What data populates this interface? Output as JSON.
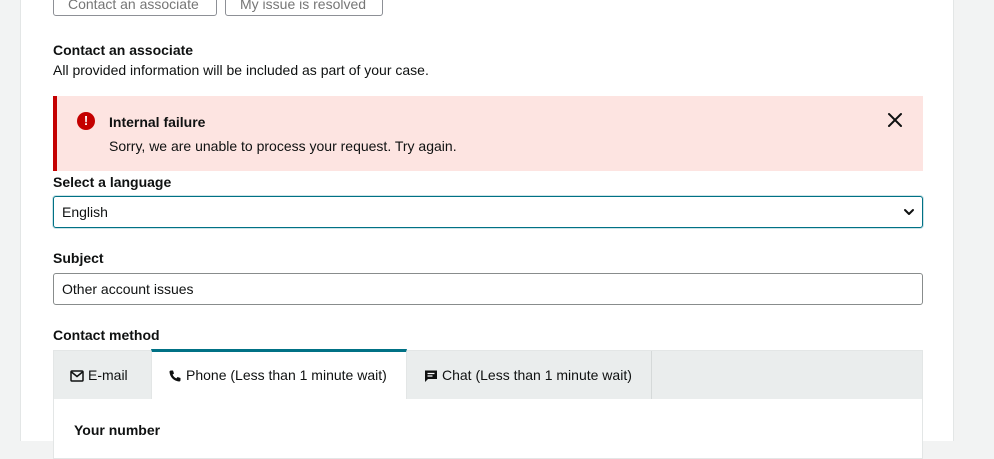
{
  "top_buttons": {
    "contact_associate": "Contact an associate",
    "issue_resolved": "My issue is resolved"
  },
  "section": {
    "title": "Contact an associate",
    "subtitle": "All provided information will be included as part of your case."
  },
  "alert": {
    "icon": "!",
    "title": "Internal failure",
    "message": "Sorry, we are unable to process your request. Try again.",
    "color": "#c40000",
    "background": "#fde4e1"
  },
  "language": {
    "label": "Select a language",
    "selected": "English"
  },
  "subject": {
    "label": "Subject",
    "value": "Other account issues"
  },
  "contact_method": {
    "label": "Contact method",
    "tabs": [
      {
        "label": "E-mail",
        "icon": "mail-icon"
      },
      {
        "label": "Phone (Less than 1 minute wait)",
        "icon": "phone-icon",
        "active": true
      },
      {
        "label": "Chat (Less than 1 minute wait)",
        "icon": "chat-icon"
      }
    ],
    "accent": "#007185"
  },
  "phone_form": {
    "number_label": "Your number"
  }
}
